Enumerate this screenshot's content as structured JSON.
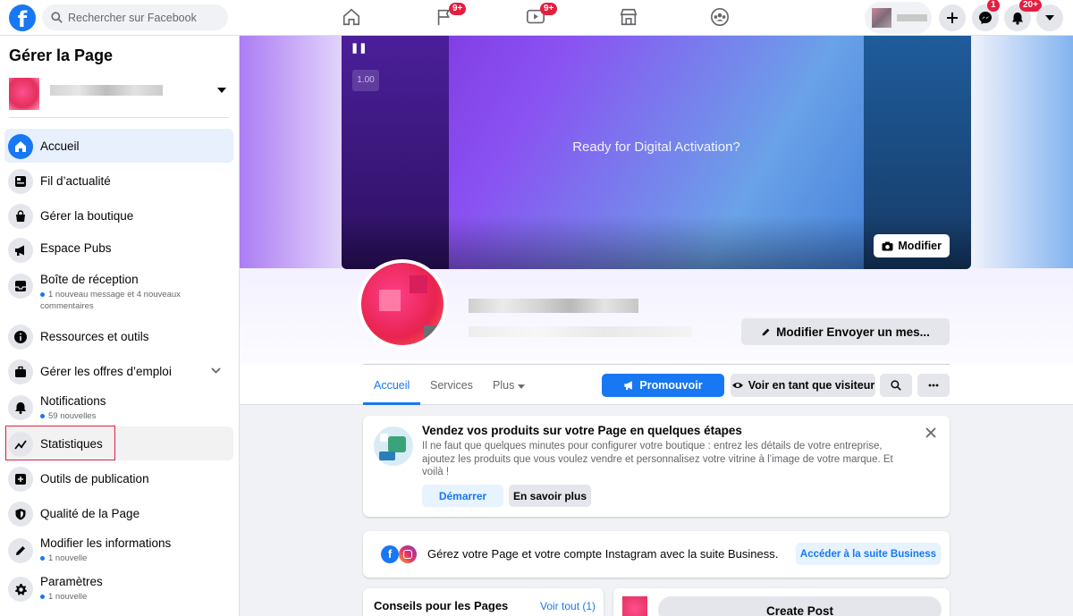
{
  "topbar": {
    "search_placeholder": "Rechercher sur Facebook",
    "nav": [
      {
        "icon": "home-icon"
      },
      {
        "icon": "flag-icon",
        "badge": "9+"
      },
      {
        "icon": "watch-icon",
        "badge": "9+"
      },
      {
        "icon": "marketplace-icon"
      },
      {
        "icon": "groups-icon"
      }
    ],
    "messenger_badge": "1",
    "notifications_badge": "20+"
  },
  "sidebar": {
    "title": "Gérer la Page",
    "items": [
      {
        "label": "Accueil",
        "icon": "home-icon"
      },
      {
        "label": "Fil d’actualité",
        "icon": "newsfeed-icon"
      },
      {
        "label": "Gérer la boutique",
        "icon": "shopping-bag-icon"
      },
      {
        "label": "Espace Pubs",
        "icon": "megaphone-icon"
      },
      {
        "label": "Boîte de réception",
        "icon": "inbox-icon",
        "sub": "1 nouveau message et 4 nouveaux commentaires"
      },
      {
        "label": "Ressources et outils",
        "icon": "info-icon"
      },
      {
        "label": "Gérer les offres d’emploi",
        "icon": "briefcase-icon"
      },
      {
        "label": "Notifications",
        "icon": "bell-icon",
        "sub": "59 nouvelles"
      },
      {
        "label": "Statistiques",
        "icon": "insights-icon"
      },
      {
        "label": "Outils de publication",
        "icon": "publishing-tools-icon"
      },
      {
        "label": "Qualité de la Page",
        "icon": "shield-icon"
      },
      {
        "label": "Modifier les informations",
        "icon": "pencil-icon",
        "sub": "1 nouvelle"
      },
      {
        "label": "Paramètres",
        "icon": "gear-icon",
        "sub": "1 nouvelle"
      }
    ]
  },
  "cover": {
    "text": "Ready for Digital Activation?",
    "speed": "1.00",
    "edit_label": "Modifier"
  },
  "profile": {
    "edit_send_label": "Modifier Envoyer un mes..."
  },
  "tabs": [
    {
      "label": "Accueil",
      "active": true
    },
    {
      "label": "Services"
    },
    {
      "label": "Plus"
    }
  ],
  "actions": {
    "promote_label": "Promouvoir",
    "view_as_label": "Voir en tant que visiteur"
  },
  "shop_card": {
    "title": "Vendez vos produits sur votre Page en quelques étapes",
    "text": "Il ne faut que quelques minutes pour configurer votre boutique : entrez les détails de votre entreprise, ajoutez les produits que vous voulez vendre et personnalisez votre vitrine à l’image de votre marque. Et voilà !",
    "start_label": "Démarrer",
    "learn_label": "En savoir plus"
  },
  "business_card": {
    "text": "Gérez votre Page et votre compte Instagram avec la suite Business.",
    "link_label": "Accéder à la suite Business"
  },
  "tips_card": {
    "title": "Conseils pour les Pages",
    "see_all": "Voir tout (1)"
  },
  "composer": {
    "create_post_label": "Create Post"
  },
  "colors": {
    "brand": "#1877f2",
    "badge": "#e41e3f",
    "highlight": "#e41e3f"
  }
}
